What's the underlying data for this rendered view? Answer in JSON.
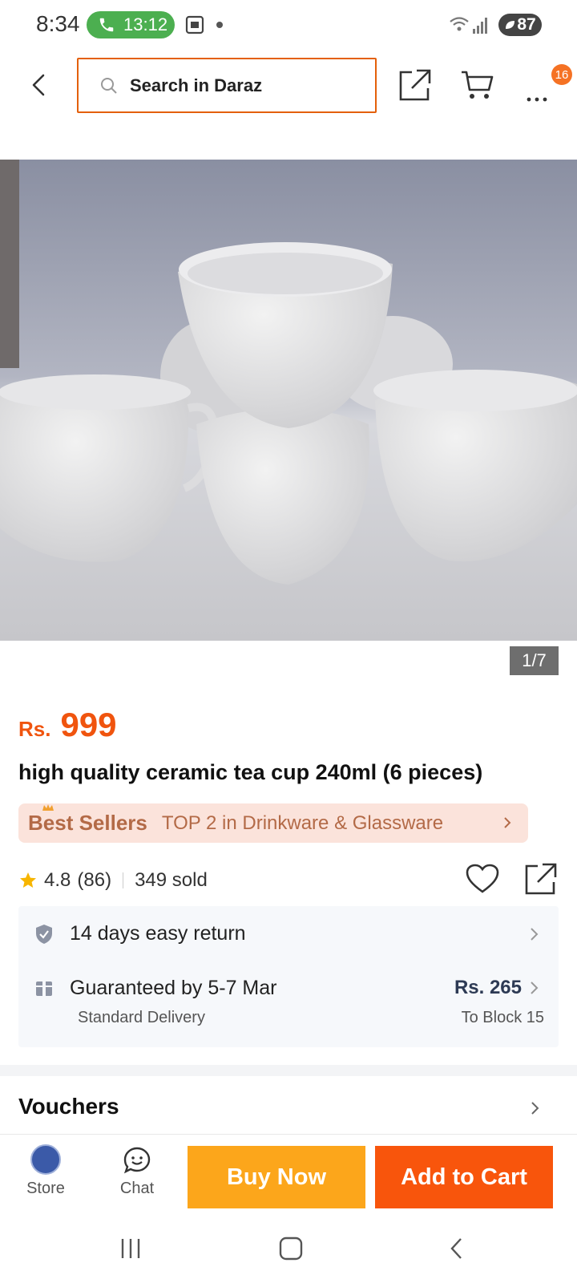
{
  "status_bar": {
    "time": "8:34",
    "call_timer": "13:12",
    "battery": "87"
  },
  "top_bar": {
    "search_placeholder": "Search in Daraz",
    "cart_badge": "16"
  },
  "gallery": {
    "counter": "1/7"
  },
  "product": {
    "currency": "Rs.",
    "price": "999",
    "title": "high quality ceramic tea cup 240ml (6 pieces)",
    "bestseller_tag": "Best Sellers",
    "bestseller_text": "TOP 2 in Drinkware & Glassware",
    "rating": "4.8",
    "rating_count": "(86)",
    "sold": "349 sold"
  },
  "services": {
    "return_label": "14 days easy return",
    "delivery_label": "Guaranteed by 5-7 Mar",
    "delivery_type": "Standard Delivery",
    "delivery_price": "Rs. 265",
    "delivery_destination": "To Block 15"
  },
  "vouchers": {
    "title": "Vouchers"
  },
  "actions": {
    "store_label": "Store",
    "chat_label": "Chat",
    "buy_now_label": "Buy Now",
    "add_to_cart_label": "Add to Cart"
  },
  "colors": {
    "brand_orange": "#f57224",
    "price_orange": "#f0540e",
    "buy_now_yellow": "#fca61b",
    "add_cart_orange": "#f8550c",
    "bestseller_bg": "#fbe3db"
  }
}
